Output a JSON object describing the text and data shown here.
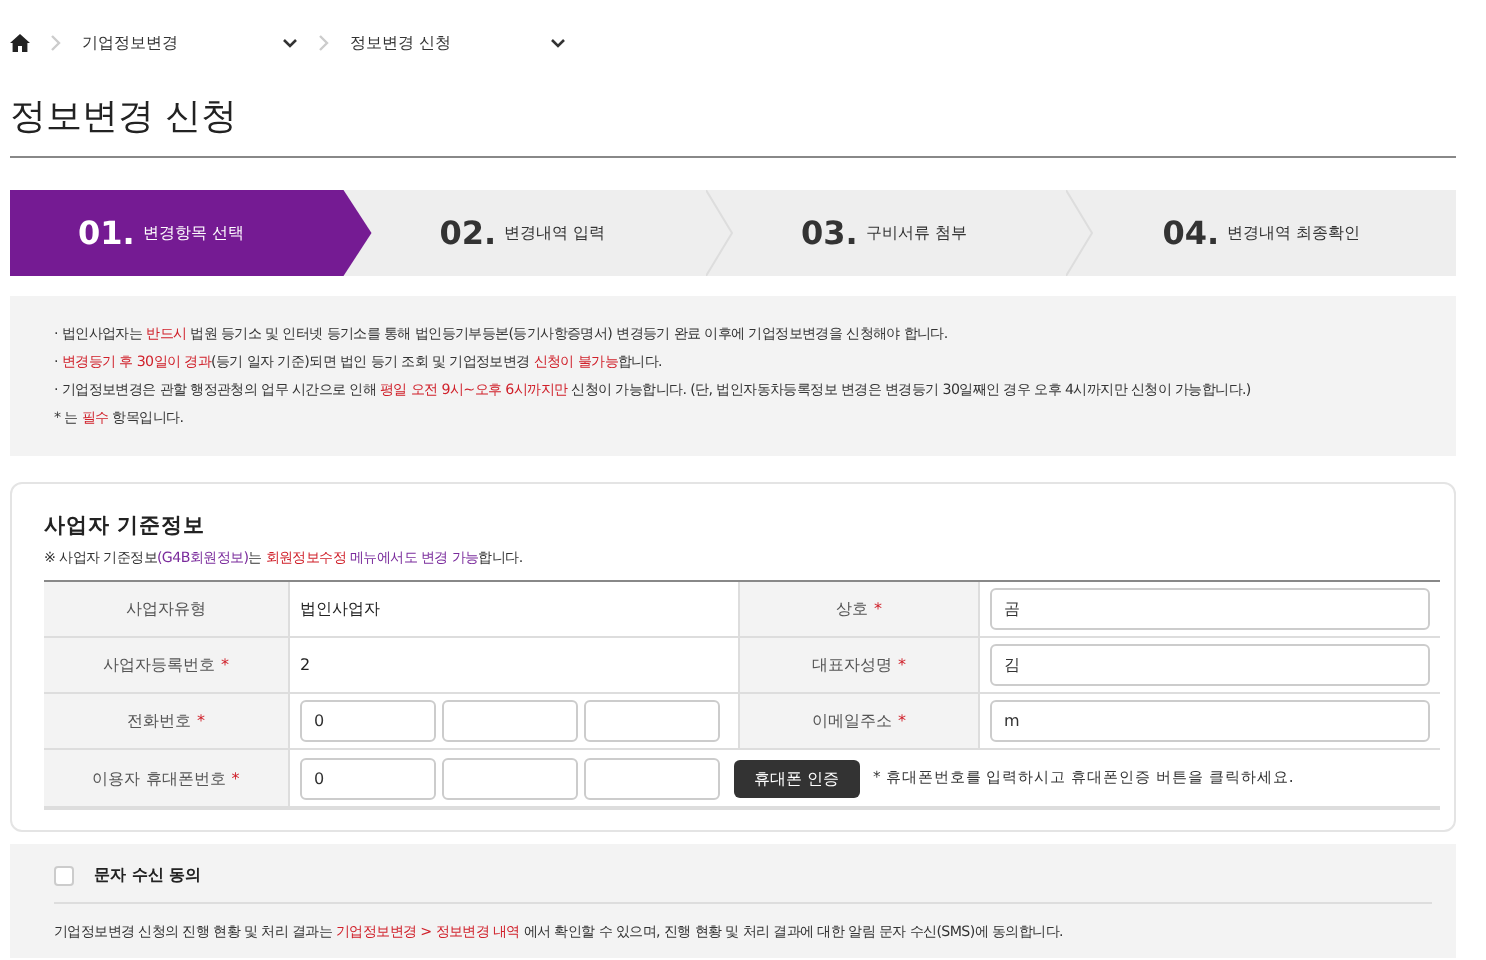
{
  "breadcrumb": {
    "items": [
      {
        "label": "기업정보변경"
      },
      {
        "label": "정보변경 신청"
      }
    ]
  },
  "page_title": "정보변경 신청",
  "steps": [
    {
      "number": "01.",
      "label": "변경항목 선택",
      "selected": true
    },
    {
      "number": "02.",
      "label": "변경내역 입력",
      "selected": false
    },
    {
      "number": "03.",
      "label": "구비서류 첨부",
      "selected": false
    },
    {
      "number": "04.",
      "label": "변경내역 최종확인",
      "selected": false
    }
  ],
  "notices": [
    [
      {
        "text": "· 법인사업자는 "
      },
      {
        "text": "반드시",
        "color": "#d0202a"
      },
      {
        "text": " 법원 등기소 및 인터넷 등기소를 통해 법인등기부등본(등기사항증명서) 변경등기 완료 이후에 기업정보변경을 신청해야 합니다."
      }
    ],
    [
      {
        "text": "· "
      },
      {
        "text": "변경등기 후 30일이 경과",
        "color": "#d0202a"
      },
      {
        "text": "(등기 일자 기준)되면 법인 등기 조회 및 기업정보변경 "
      },
      {
        "text": "신청이 불가능",
        "color": "#d0202a"
      },
      {
        "text": "합니다."
      }
    ],
    [
      {
        "text": "· 기업정보변경은 관할 행정관청의 업무 시간으로 인해 "
      },
      {
        "text": "평일 오전 9시~오후 6시까지만",
        "color": "#d0202a"
      },
      {
        "text": " 신청이 가능합니다. (단, 법인자동차등록정보 변경은 변경등기 30일째인 경우 오후 4시까지만 신청이 가능합니다.)"
      }
    ],
    [
      {
        "text": " * 는 "
      },
      {
        "text": "필수",
        "color": "#d0202a"
      },
      {
        "text": " 항목입니다."
      }
    ]
  ],
  "business_info": {
    "title": "사업자 기준정보",
    "note": [
      {
        "text": "※ 사업자 기준정보"
      },
      {
        "text": "(G4B회원정보)",
        "color": "#7a2b9c"
      },
      {
        "text": "는 "
      },
      {
        "text": "회원정보수정",
        "color": "#d0202a"
      },
      {
        "text": " 메뉴에서도 변경 가능",
        "color": "#7a2b9c"
      },
      {
        "text": "합니다."
      }
    ],
    "rows": [
      [
        {
          "label": "사업자유형",
          "kind": "text",
          "value": "법인사업자"
        },
        {
          "label": "상호",
          "required_mark": "*",
          "kind": "input",
          "value": "곰"
        }
      ],
      [
        {
          "label": "사업자등록번호",
          "required_mark": "*",
          "kind": "text",
          "value": "2"
        },
        {
          "label": "대표자성명",
          "required_mark": "*",
          "kind": "input",
          "value": "김"
        }
      ],
      [
        {
          "label": "전화번호",
          "required_mark": "*",
          "kind": "triple",
          "value": "0"
        },
        {
          "label": "이메일주소",
          "required_mark": "*",
          "kind": "input",
          "value": "m"
        }
      ]
    ],
    "mobile": {
      "label": "이용자 휴대폰번호",
      "required_mark": "*",
      "value": "0",
      "button": "휴대폰 인증",
      "hint": "* 휴대폰번호를 입력하시고 휴대폰인증 버튼을 클릭하세요."
    }
  },
  "sms_consent": {
    "label": "문자 수신 동의",
    "checked": false,
    "text": [
      {
        "text": "기업정보변경 신청의 진행 현황 및 처리 결과는 "
      },
      {
        "text": "기업정보변경 > 정보변경 내역",
        "color": "#d0202a"
      },
      {
        "text": " 에서 확인할 수 있으며, 진행 현황 및 처리 결과에 대한 알림 문자 수신(SMS)에 동의합니다."
      }
    ]
  }
}
